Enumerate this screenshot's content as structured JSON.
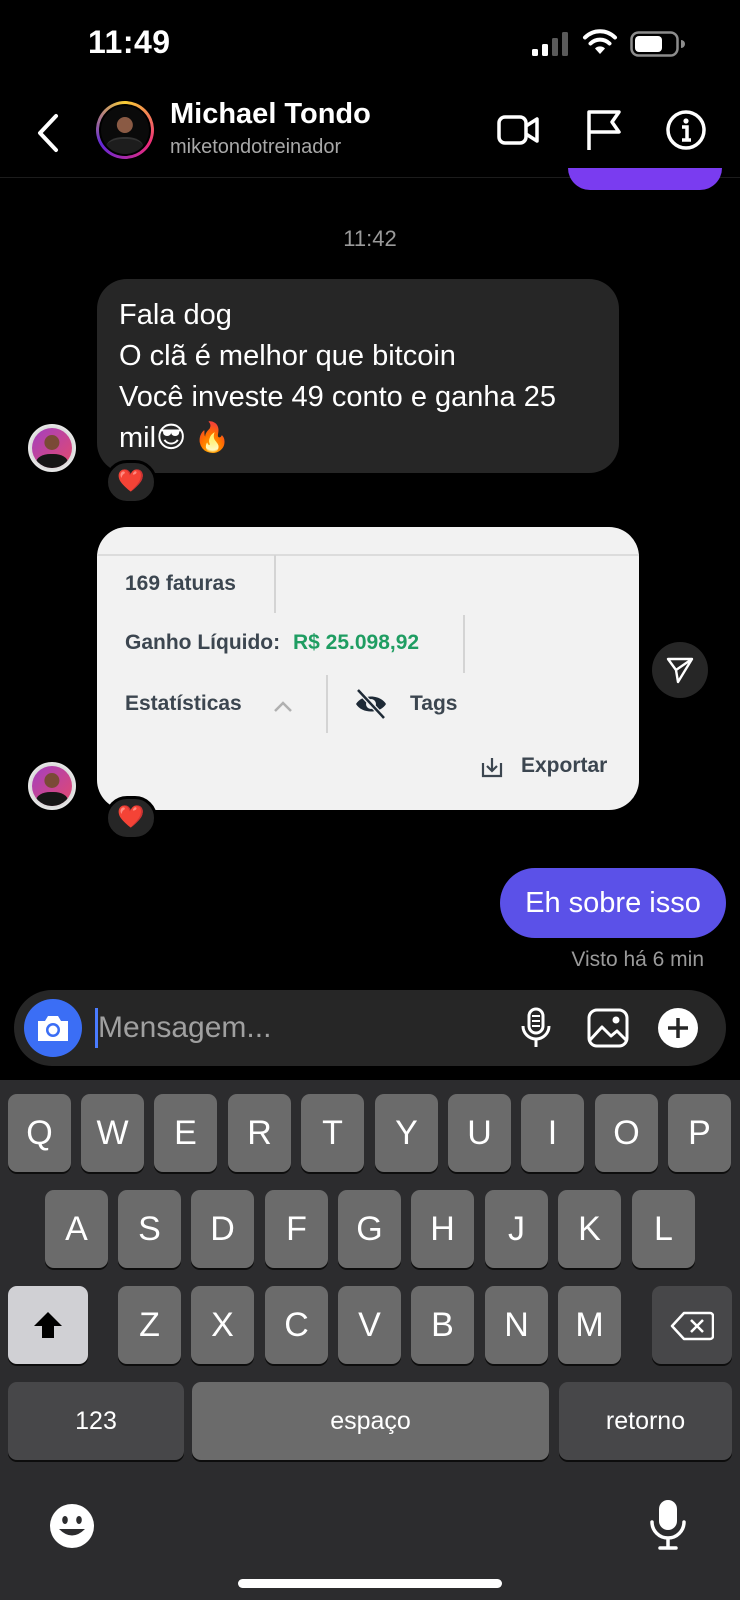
{
  "status_bar": {
    "time": "11:49"
  },
  "header": {
    "name": "Michael Tondo",
    "username": "miketondotreinador"
  },
  "chat": {
    "timestamp": "11:42",
    "incoming_message": {
      "lines": [
        "Fala dog",
        "O clã é melhor que bitcoin",
        "Você investe 49 conto e ganha 25",
        "mil😎 🔥"
      ],
      "reaction": "❤️"
    },
    "screenshot_card": {
      "invoices": "169 faturas",
      "net_gain_label": "Ganho Líquido:",
      "net_gain_value": "R$ 25.098,92",
      "stats_label": "Estatísticas",
      "tags_label": "Tags",
      "export_label": "Exportar",
      "reaction": "❤️"
    },
    "outgoing_message": {
      "text": "Eh sobre isso",
      "seen": "Visto há 6 min"
    }
  },
  "composer": {
    "placeholder": "Mensagem..."
  },
  "keyboard": {
    "row1": [
      "Q",
      "W",
      "E",
      "R",
      "T",
      "Y",
      "U",
      "I",
      "O",
      "P"
    ],
    "row2": [
      "A",
      "S",
      "D",
      "F",
      "G",
      "H",
      "J",
      "K",
      "L"
    ],
    "row3": [
      "Z",
      "X",
      "C",
      "V",
      "B",
      "N",
      "M"
    ],
    "numbers_label": "123",
    "space_label": "espaço",
    "return_label": "retorno"
  },
  "icons": {
    "back": "chevron-left-icon",
    "video": "video-camera-icon",
    "flag": "flag-icon",
    "info": "info-icon",
    "camera": "camera-icon",
    "mic": "microphone-icon",
    "gallery": "image-icon",
    "plus": "plus-icon",
    "shift": "shift-icon",
    "backspace": "backspace-icon",
    "emoji": "emoji-icon",
    "dictation": "microphone-icon"
  },
  "colors": {
    "outgoing_bubble": "#5b51e8",
    "incoming_bubble": "#262626",
    "camera_button": "#3b6ef5",
    "gain_green": "#1f9d62"
  }
}
